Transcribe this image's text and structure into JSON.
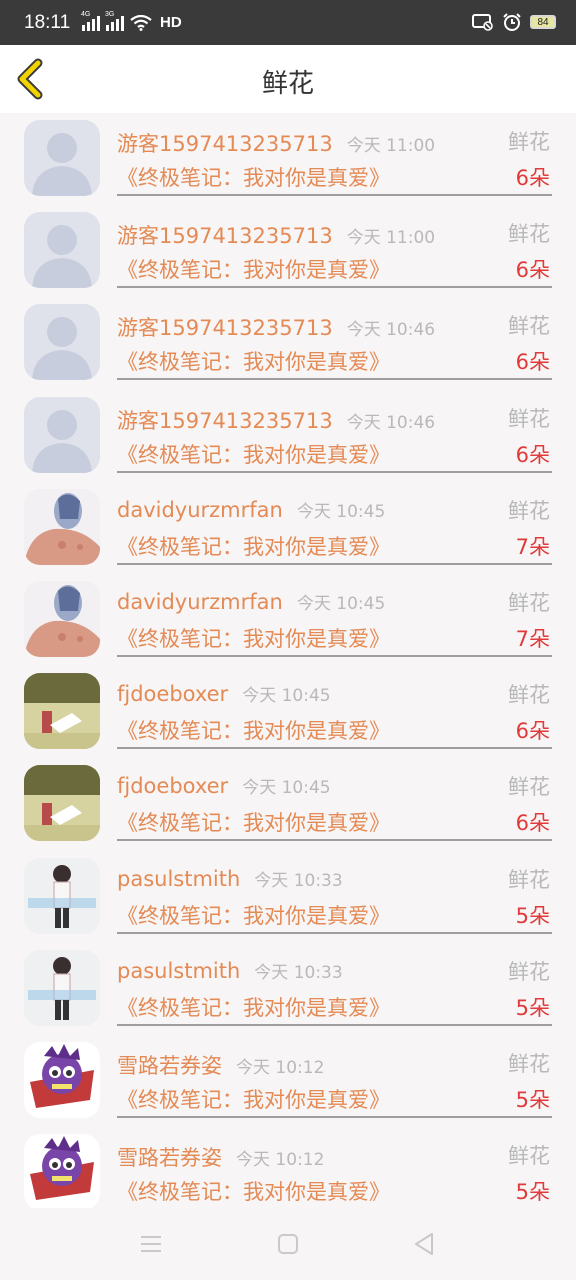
{
  "status": {
    "time": "18:11",
    "sig1": "4G",
    "sig2": "3G",
    "hd": "HD",
    "battery": "84"
  },
  "header": {
    "title": "鲜花"
  },
  "rows": [
    {
      "name": "游客1597413235713",
      "time": "今天 11:00",
      "type": "鲜花",
      "book": "《终极笔记：我对你是真爱》",
      "count": "6朵",
      "avatar": "default"
    },
    {
      "name": "游客1597413235713",
      "time": "今天 11:00",
      "type": "鲜花",
      "book": "《终极笔记：我对你是真爱》",
      "count": "6朵",
      "avatar": "default"
    },
    {
      "name": "游客1597413235713",
      "time": "今天 10:46",
      "type": "鲜花",
      "book": "《终极笔记：我对你是真爱》",
      "count": "6朵",
      "avatar": "default"
    },
    {
      "name": "游客1597413235713",
      "time": "今天 10:46",
      "type": "鲜花",
      "book": "《终极笔记：我对你是真爱》",
      "count": "6朵",
      "avatar": "default"
    },
    {
      "name": "davidyurzmrfan",
      "time": "今天 10:45",
      "type": "鲜花",
      "book": "《终极笔记：我对你是真爱》",
      "count": "7朵",
      "avatar": "person"
    },
    {
      "name": "davidyurzmrfan",
      "time": "今天 10:45",
      "type": "鲜花",
      "book": "《终极笔记：我对你是真爱》",
      "count": "7朵",
      "avatar": "person"
    },
    {
      "name": "fjdoeboxer",
      "time": "今天 10:45",
      "type": "鲜花",
      "book": "《终极笔记：我对你是真爱》",
      "count": "6朵",
      "avatar": "photo"
    },
    {
      "name": "fjdoeboxer",
      "time": "今天 10:45",
      "type": "鲜花",
      "book": "《终极笔记：我对你是真爱》",
      "count": "6朵",
      "avatar": "photo"
    },
    {
      "name": "pasulstmith",
      "time": "今天 10:33",
      "type": "鲜花",
      "book": "《终极笔记：我对你是真爱》",
      "count": "5朵",
      "avatar": "boy"
    },
    {
      "name": "pasulstmith",
      "time": "今天 10:33",
      "type": "鲜花",
      "book": "《终极笔记：我对你是真爱》",
      "count": "5朵",
      "avatar": "boy"
    },
    {
      "name": "雪路若券姿",
      "time": "今天 10:12",
      "type": "鲜花",
      "book": "《终极笔记：我对你是真爱》",
      "count": "5朵",
      "avatar": "monster"
    },
    {
      "name": "雪路若券姿",
      "time": "今天 10:12",
      "type": "鲜花",
      "book": "《终极笔记：我对你是真爱》",
      "count": "5朵",
      "avatar": "monster"
    }
  ],
  "icons": {
    "back": "chevron-left-icon",
    "menu": "menu-icon",
    "home": "home-icon",
    "nav_back": "nav-back-icon"
  },
  "colors": {
    "accent": "#e48a55",
    "count": "#e03a3a",
    "back": "#f2d300"
  }
}
